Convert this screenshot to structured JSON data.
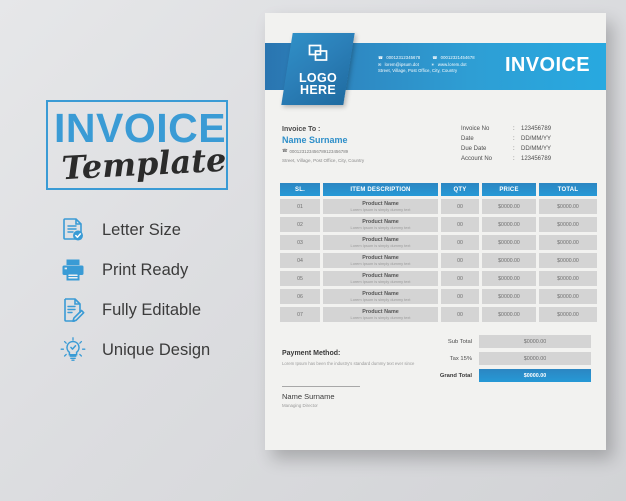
{
  "promo": {
    "title_main": "INVOICE",
    "title_sub": "Template",
    "features": [
      {
        "icon": "document-check-icon",
        "label": "Letter Size"
      },
      {
        "icon": "printer-icon",
        "label": "Print Ready"
      },
      {
        "icon": "document-pencil-icon",
        "label": "Fully Editable"
      },
      {
        "icon": "lightbulb-check-icon",
        "label": "Unique Design"
      }
    ]
  },
  "invoice": {
    "logo": {
      "line1": "LOGO",
      "line2": "HERE",
      "icon": "overlapping-squares-icon"
    },
    "header": {
      "title": "INVOICE",
      "phone1": "00012312345678",
      "phone2": "00012321454678",
      "email": "lorem@ipsum.dot",
      "website": "www.lorem.dot",
      "address": "Street, Village, Post Office, City, Country"
    },
    "bill_to": {
      "label": "Invoice To :",
      "name": "Name Surname",
      "phone": "000123123456789123456789",
      "address": "Street, Village, Post Office, City, Country"
    },
    "meta": [
      {
        "key": "Invoice No",
        "value": "123456789"
      },
      {
        "key": "Date",
        "value": "DD/MM/YY"
      },
      {
        "key": "Due Date",
        "value": "DD/MM/YY"
      },
      {
        "key": "Account No",
        "value": "123456789"
      }
    ],
    "table": {
      "headers": [
        "SL.",
        "ITEM DESCRIPTION",
        "QTY",
        "PRICE",
        "TOTAL"
      ],
      "rows": [
        {
          "sl": "01",
          "name": "Product Name",
          "desc": "Lorem Ipsum is simply dummy text",
          "qty": "00",
          "price": "$0000.00",
          "total": "$0000.00"
        },
        {
          "sl": "02",
          "name": "Product Name",
          "desc": "Lorem Ipsum is simply dummy text",
          "qty": "00",
          "price": "$0000.00",
          "total": "$0000.00"
        },
        {
          "sl": "03",
          "name": "Product Name",
          "desc": "Lorem Ipsum is simply dummy text",
          "qty": "00",
          "price": "$0000.00",
          "total": "$0000.00"
        },
        {
          "sl": "04",
          "name": "Product Name",
          "desc": "Lorem Ipsum is simply dummy text",
          "qty": "00",
          "price": "$0000.00",
          "total": "$0000.00"
        },
        {
          "sl": "05",
          "name": "Product Name",
          "desc": "Lorem Ipsum is simply dummy text",
          "qty": "00",
          "price": "$0000.00",
          "total": "$0000.00"
        },
        {
          "sl": "06",
          "name": "Product Name",
          "desc": "Lorem Ipsum is simply dummy text",
          "qty": "00",
          "price": "$0000.00",
          "total": "$0000.00"
        },
        {
          "sl": "07",
          "name": "Product Name",
          "desc": "Lorem Ipsum is simply dummy text",
          "qty": "00",
          "price": "$0000.00",
          "total": "$0000.00"
        }
      ]
    },
    "totals": [
      {
        "label": "Sub Total",
        "value": "$0000.00",
        "highlight": false
      },
      {
        "label": "Tax 15%",
        "value": "$0000.00",
        "highlight": false
      },
      {
        "label": "Grand Total",
        "value": "$0000.00",
        "highlight": true
      }
    ],
    "payment": {
      "title": "Payment Method:",
      "text": "Lorem Ipsum has been the industry's standard dummy text ever since"
    },
    "signature": {
      "name": "Name Surname",
      "role": "Managing Director"
    }
  },
  "colors": {
    "accent_blue": "#2e9ed4",
    "deep_blue": "#2a6ca3",
    "light_blue": "#3a9bd5",
    "row_gray": "#d4d4d4"
  }
}
